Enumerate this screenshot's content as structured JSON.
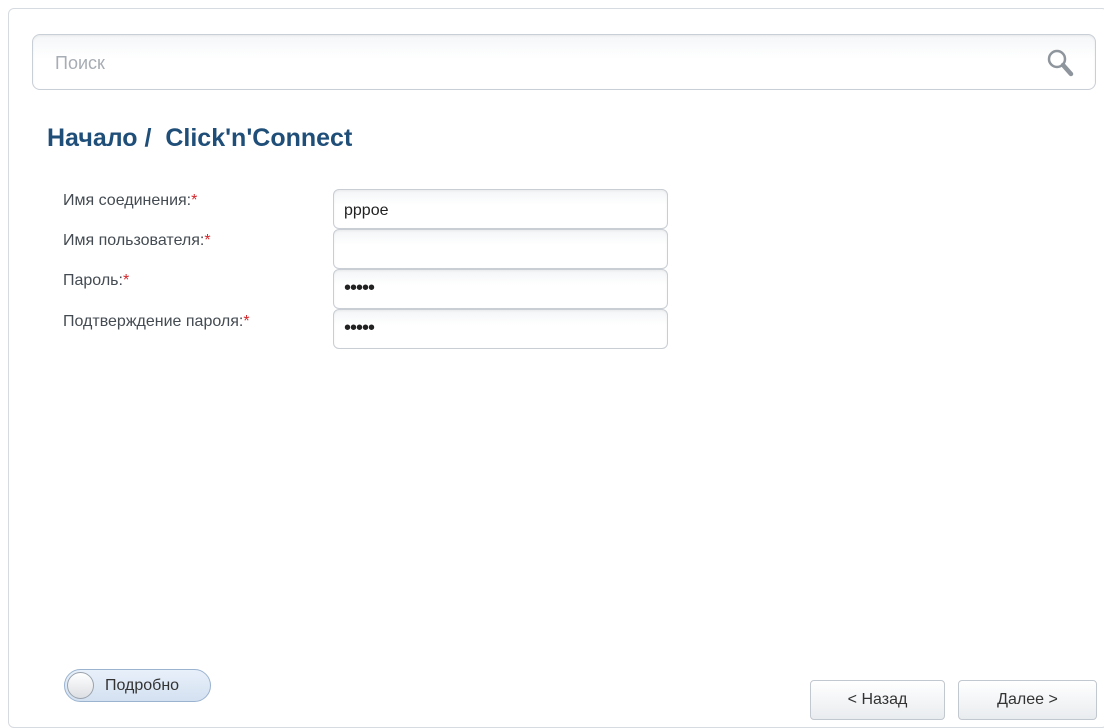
{
  "search": {
    "placeholder": "Поиск",
    "icon": "search-icon"
  },
  "page": {
    "title": "Начало /  Click'n'Connect"
  },
  "form": {
    "required_mark": "*",
    "fields": [
      {
        "label": "Имя соединения:",
        "value": "pppoe"
      },
      {
        "label": "Имя пользователя:",
        "value": ""
      },
      {
        "label": "Пароль:",
        "value": "•••••"
      },
      {
        "label": "Подтверждение пароля:",
        "value": "•••••"
      }
    ]
  },
  "toggle": {
    "label": "Подробно",
    "state": "off"
  },
  "buttons": {
    "back": "< Назад",
    "next": "Далее >"
  },
  "colors": {
    "title": "#1f4e79",
    "required": "#d4262b"
  }
}
